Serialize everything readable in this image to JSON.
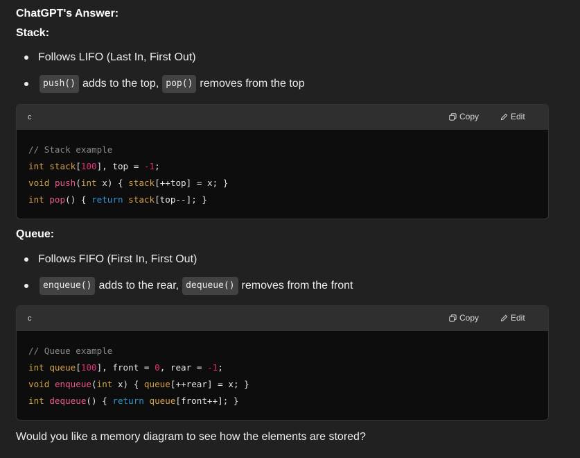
{
  "title": "ChatGPT's Answer:",
  "stack": {
    "heading": "Stack:",
    "bullet1": "Follows LIFO (Last In, First Out)",
    "bullet2": {
      "code1": "push()",
      "text1": "adds to the top,",
      "code2": "pop()",
      "text2": "removes from the top"
    },
    "codeblock": {
      "language": "c",
      "copy_label": "Copy",
      "edit_label": "Edit",
      "lines": [
        "// Stack example",
        "int stack[100], top = -1;",
        "void push(int x) { stack[++top] = x; }",
        "int pop() { return stack[top--]; }"
      ]
    }
  },
  "queue": {
    "heading": "Queue:",
    "bullet1": "Follows FIFO (First In, First Out)",
    "bullet2": {
      "code1": "enqueue()",
      "text1": "adds to the rear,",
      "code2": "dequeue()",
      "text2": "removes from the front"
    },
    "codeblock": {
      "language": "c",
      "copy_label": "Copy",
      "edit_label": "Edit",
      "lines": [
        "// Queue example",
        "int queue[100], front = 0, rear = -1;",
        "void enqueue(int x) { queue[++rear] = x; }",
        "int dequeue() { return queue[front++]; }"
      ]
    }
  },
  "footer": "Would you like a memory diagram to see how the elements are stored?",
  "colors": {
    "background": "#212121",
    "code_background": "#0d0d0d",
    "code_header": "#2f2f2f",
    "inline_code_bg": "#424242",
    "keyword_blue": "#2e95d3",
    "number_pink": "#df3079",
    "type_orange": "#d2a24c",
    "comment_gray": "#8a8a8a"
  },
  "icons": [
    "copy-icon",
    "edit-icon"
  ]
}
